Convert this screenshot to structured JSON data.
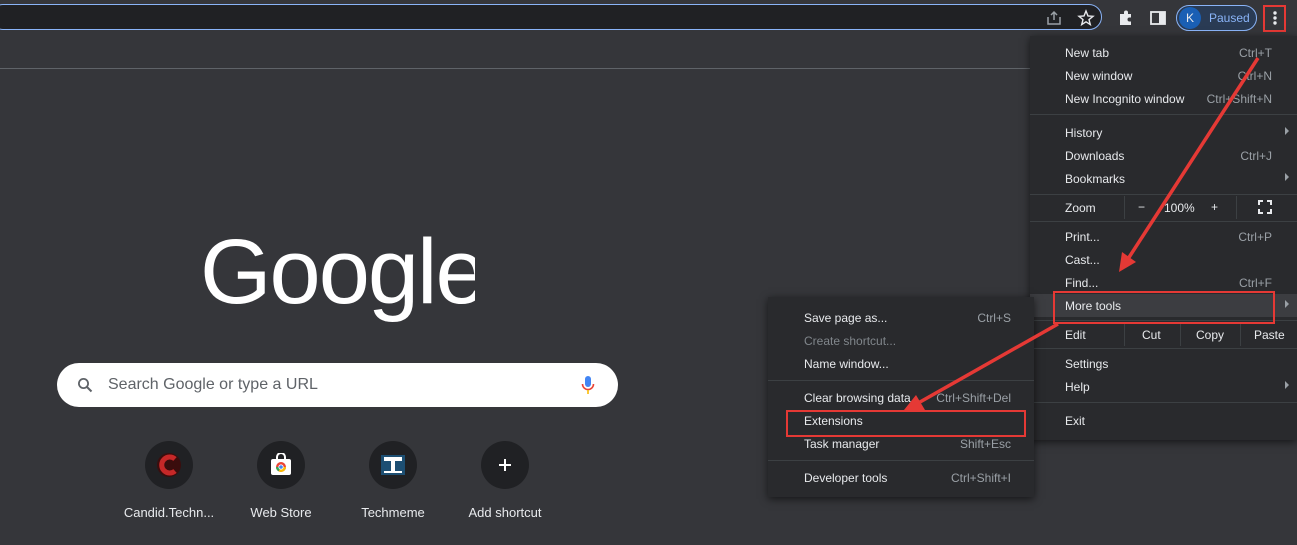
{
  "profile": {
    "avatar_letter": "K",
    "status": "Paused"
  },
  "search": {
    "placeholder": "Search Google or type a URL"
  },
  "shortcuts": [
    {
      "label": "Candid.Techn..."
    },
    {
      "label": "Web Store"
    },
    {
      "label": "Techmeme"
    },
    {
      "label": "Add shortcut"
    }
  ],
  "menu": {
    "new_tab": {
      "label": "New tab",
      "shortcut": "Ctrl+T"
    },
    "new_window": {
      "label": "New window",
      "shortcut": "Ctrl+N"
    },
    "new_incognito": {
      "label": "New Incognito window",
      "shortcut": "Ctrl+Shift+N"
    },
    "history": {
      "label": "History"
    },
    "downloads": {
      "label": "Downloads",
      "shortcut": "Ctrl+J"
    },
    "bookmarks": {
      "label": "Bookmarks"
    },
    "zoom": {
      "label": "Zoom",
      "minus": "−",
      "value": "100%",
      "plus": "+"
    },
    "print": {
      "label": "Print...",
      "shortcut": "Ctrl+P"
    },
    "cast": {
      "label": "Cast..."
    },
    "find": {
      "label": "Find...",
      "shortcut": "Ctrl+F"
    },
    "more_tools": {
      "label": "More tools"
    },
    "edit": {
      "label": "Edit",
      "cut": "Cut",
      "copy": "Copy",
      "paste": "Paste"
    },
    "settings": {
      "label": "Settings"
    },
    "help": {
      "label": "Help"
    },
    "exit": {
      "label": "Exit"
    }
  },
  "submenu": {
    "save_page": {
      "label": "Save page as...",
      "shortcut": "Ctrl+S"
    },
    "create_shortcut": {
      "label": "Create shortcut..."
    },
    "name_window": {
      "label": "Name window..."
    },
    "clear_browsing": {
      "label": "Clear browsing data...",
      "shortcut": "Ctrl+Shift+Del"
    },
    "extensions": {
      "label": "Extensions"
    },
    "task_manager": {
      "label": "Task manager",
      "shortcut": "Shift+Esc"
    },
    "developer_tools": {
      "label": "Developer tools",
      "shortcut": "Ctrl+Shift+I"
    }
  },
  "colors": {
    "highlight": "#e53935",
    "accent": "#8ab4f8",
    "menu_bg": "#292a2d",
    "page_bg": "#35363a"
  }
}
